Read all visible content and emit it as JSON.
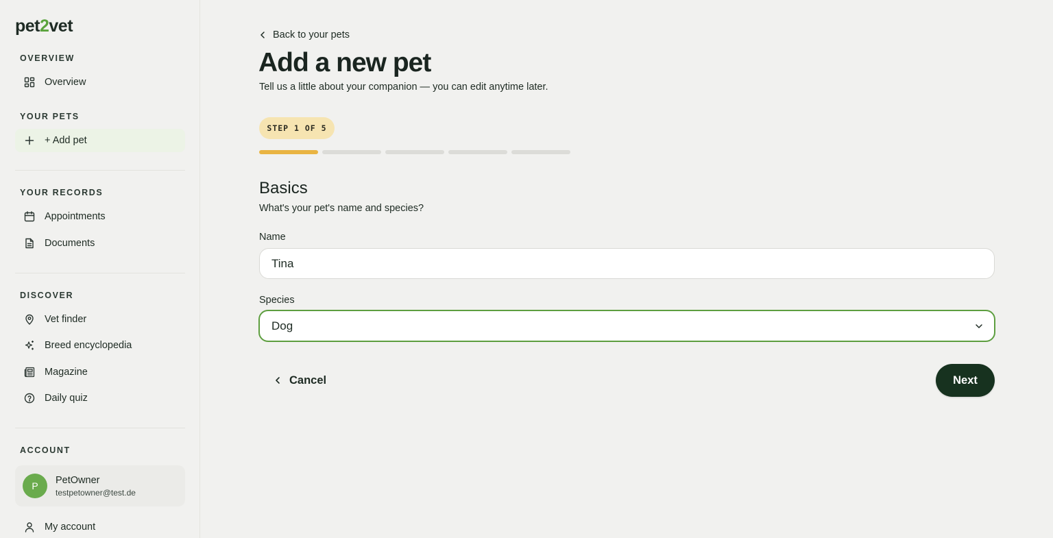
{
  "sidebar": {
    "logo": {
      "part1": "pet",
      "part2": "2",
      "part3": "vet"
    },
    "sections": {
      "overview": "OVERVIEW",
      "your_pets": "YOUR PETS",
      "your_records": "YOUR RECORDS",
      "discover": "DISCOVER",
      "account": "ACCOUNT"
    },
    "items": {
      "overview": "Overview",
      "add_pet": "+ Add pet",
      "appointments": "Appointments",
      "documents": "Documents",
      "vet_finder": "Vet finder",
      "breed_encyclopedia": "Breed encyclopedia",
      "magazine": "Magazine",
      "daily_quiz": "Daily quiz",
      "my_account": "My account"
    },
    "user": {
      "initial": "P",
      "name": "PetOwner",
      "email": "testpetowner@test.de"
    }
  },
  "main": {
    "back_label": "Back to your pets",
    "title": "Add a new pet",
    "subtitle": "Tell us a little about your companion — you can edit anytime later.",
    "step_badge": "STEP 1 OF 5",
    "progress": {
      "current": 1,
      "total": 5
    },
    "section_title": "Basics",
    "section_desc": "What's your pet's name and species?",
    "name_label": "Name",
    "name_value": "Tina",
    "species_label": "Species",
    "species_value": "Dog",
    "cancel_label": "Cancel",
    "next_label": "Next"
  },
  "colors": {
    "accent_green": "#5d9e3f",
    "primary_dark": "#17321f",
    "progress_active": "#e9b442",
    "badge_bg": "#f6e4b1",
    "avatar_bg": "#6aab4d"
  }
}
